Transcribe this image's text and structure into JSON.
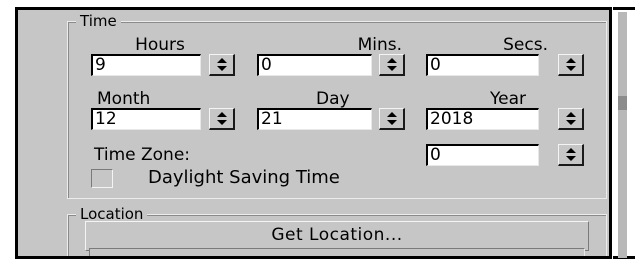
{
  "time_group": {
    "title": "Time",
    "hours_label": "Hours",
    "mins_label": "Mins.",
    "secs_label": "Secs.",
    "hours_value": "9",
    "mins_value": "0",
    "secs_value": "0",
    "month_label": "Month",
    "day_label": "Day",
    "year_label": "Year",
    "month_value": "12",
    "day_value": "21",
    "year_value": "2018",
    "timezone_label": "Time Zone:",
    "timezone_value": "0",
    "dst_label": "Daylight Saving Time",
    "dst_checked": false
  },
  "location_group": {
    "title": "Location",
    "get_location_label": "Get Location...",
    "location_value": ""
  },
  "icons": {
    "spinner": "spinner-arrows-icon"
  },
  "colors": {
    "panel_background": "#c6c6c6",
    "field_background": "#ffffff",
    "frame_border": "#000000"
  }
}
